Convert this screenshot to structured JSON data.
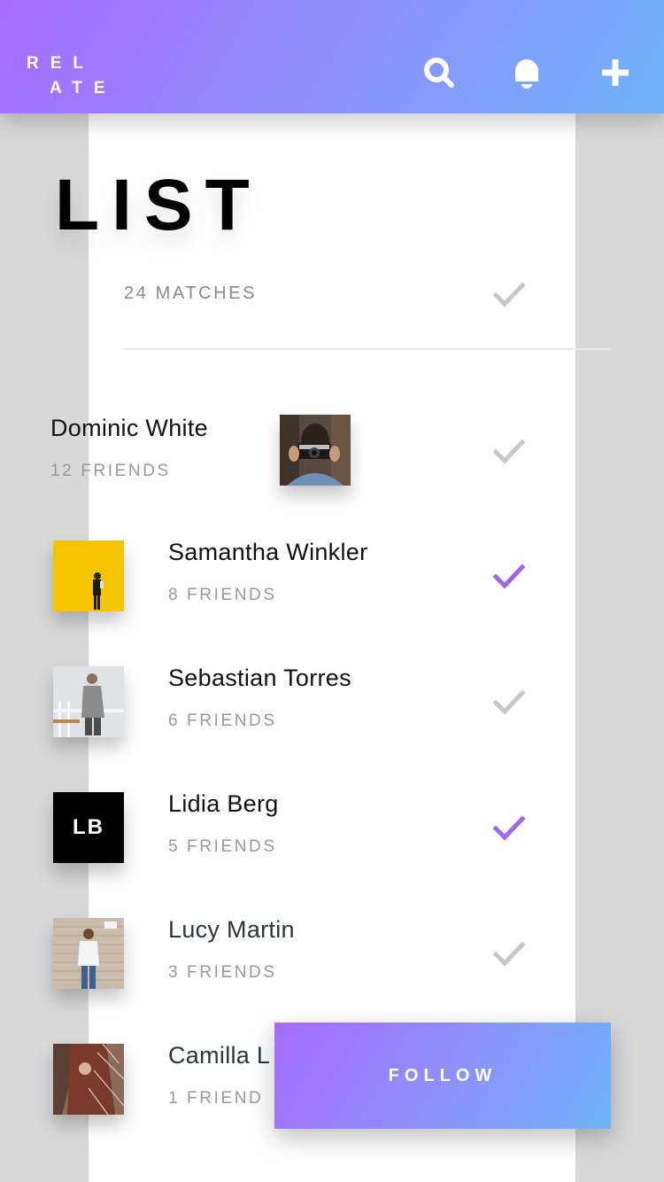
{
  "header": {
    "logo_line1": "REL",
    "logo_line2": "ATE",
    "icons": [
      "search-icon",
      "bell-icon",
      "plus-icon"
    ],
    "gradient": [
      "#a66cff",
      "#6fb4f8"
    ]
  },
  "page": {
    "title": "LIST",
    "matches": "24 MATCHES"
  },
  "colors": {
    "check_active": "#a066f0",
    "check_inactive": "#c8c8c8"
  },
  "people": [
    {
      "name": "Dominic White",
      "friends": "12 FRIENDS",
      "checked": false,
      "avatar": "photo-man-camera"
    },
    {
      "name": "Samantha Winkler",
      "friends": "8 FRIENDS",
      "checked": true,
      "avatar": "photo-yellow-wall"
    },
    {
      "name": "Sebastian Torres",
      "friends": "6 FRIENDS",
      "checked": false,
      "avatar": "photo-man-railing"
    },
    {
      "name": "Lidia Berg",
      "friends": "5 FRIENDS",
      "checked": true,
      "avatar_initials": "LB"
    },
    {
      "name": "Lucy Martin",
      "friends": "3 FRIENDS",
      "checked": false,
      "avatar": "photo-woman-wall"
    },
    {
      "name": "Camilla L",
      "friends": "1 FRIEND",
      "checked": false,
      "avatar": "photo-woman-hair"
    }
  ],
  "follow_button": "FOLLOW"
}
